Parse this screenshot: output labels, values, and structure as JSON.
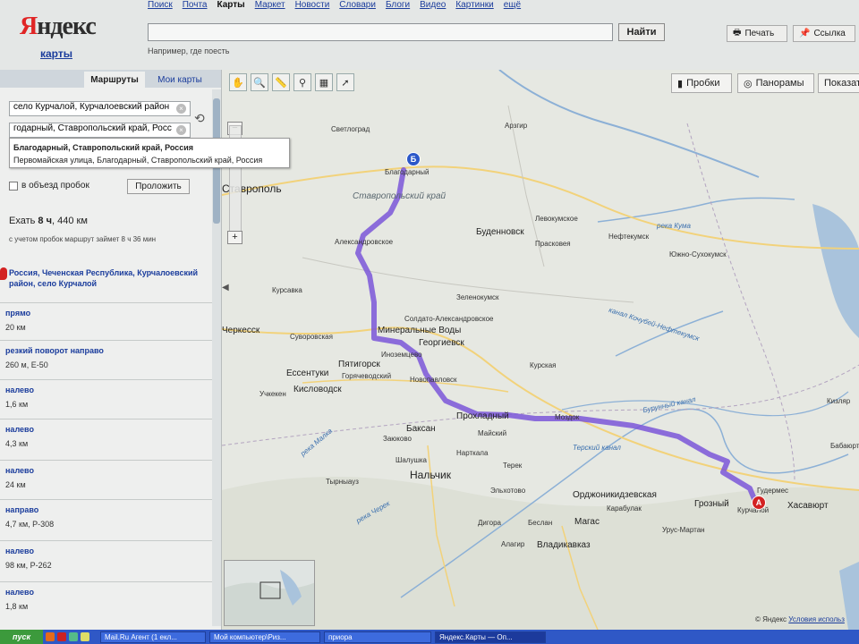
{
  "header": {
    "logo_first": "Я",
    "logo_rest": "ндекс",
    "service": "карты",
    "nav": [
      "Поиск",
      "Почта",
      "Карты",
      "Маркет",
      "Новости",
      "Словари",
      "Блоги",
      "Видео",
      "Картинки",
      "ещё"
    ],
    "active_nav": "Карты",
    "search_value": "",
    "find_label": "Найти",
    "search_hint": "Например, где поесть",
    "print_label": "Печать",
    "link_label": "Ссылка"
  },
  "sidebar": {
    "tab_routes": "Маршруты",
    "tab_mymaps": "Мои карты",
    "from_value": "село Курчалой, Курчалоевский район",
    "to_value": "годарный, Ставропольский край, Росс",
    "suggestions": [
      "Благодарный, Ставропольский край, Россия",
      "Первомайская улица, Благодарный, Ставропольский край, Россия"
    ],
    "avoid_label": "в объезд пробок",
    "build_label": "Проложить",
    "summary_prefix": "Ехать",
    "summary_time": "8 ч",
    "summary_dist": "440 км",
    "summary_traffic": "с учетом пробок маршрут займет 8 ч 36 мин",
    "start_address": "Россия, Чеченская Республика, Курчалоевский район, село Курчалой",
    "steps": [
      {
        "title": "прямо",
        "detail": "20 км"
      },
      {
        "title": "резкий поворот направо",
        "detail": "260 м, Е-50"
      },
      {
        "title": "налево",
        "detail": "1,6 км"
      },
      {
        "title": "налево",
        "detail": "4,3 км"
      },
      {
        "title": "налево",
        "detail": "24 км"
      },
      {
        "title": "направо",
        "detail": "4,7 км, Р-308"
      },
      {
        "title": "налево",
        "detail": "98 км, Р-262"
      },
      {
        "title": "налево",
        "detail": "1,8 км"
      }
    ]
  },
  "map": {
    "buttons": [
      "Пробки",
      "Панорамы",
      "Показать"
    ],
    "pin_a": "А",
    "pin_b": "Б",
    "copyright_prefix": "© Яндекс",
    "copyright_link": "Условия использ",
    "cities": [
      {
        "name": "Ставрополь",
        "cls": "big"
      },
      {
        "name": "Благодарный",
        "cls": "small"
      },
      {
        "name": "Буденновск",
        "cls": ""
      },
      {
        "name": "Светлоград",
        "cls": "small"
      },
      {
        "name": "Левокумское",
        "cls": "small"
      },
      {
        "name": "Прасковея",
        "cls": "small"
      },
      {
        "name": "Нефтекумск",
        "cls": "small"
      },
      {
        "name": "Александровское",
        "cls": "small"
      },
      {
        "name": "Южно-Сухокумск",
        "cls": "small"
      },
      {
        "name": "Зеленокумск",
        "cls": "small"
      },
      {
        "name": "Курсавка",
        "cls": "small"
      },
      {
        "name": "Солдато-Александровское",
        "cls": "small"
      },
      {
        "name": "Минеральные Воды",
        "cls": ""
      },
      {
        "name": "Суворовская",
        "cls": "small"
      },
      {
        "name": "Георгиевск",
        "cls": ""
      },
      {
        "name": "Пятигорск",
        "cls": ""
      },
      {
        "name": "Ессентуки",
        "cls": ""
      },
      {
        "name": "Кисловодск",
        "cls": ""
      },
      {
        "name": "Иноземцево",
        "cls": "small"
      },
      {
        "name": "Горячеводский",
        "cls": "small"
      },
      {
        "name": "Новопавловск",
        "cls": "small"
      },
      {
        "name": "Курская",
        "cls": "small"
      },
      {
        "name": "Прохладный",
        "cls": ""
      },
      {
        "name": "Баксан",
        "cls": ""
      },
      {
        "name": "Майский",
        "cls": "small"
      },
      {
        "name": "Заюково",
        "cls": "small"
      },
      {
        "name": "Нарткала",
        "cls": "small"
      },
      {
        "name": "Шалушка",
        "cls": "small"
      },
      {
        "name": "Нальчик",
        "cls": "big"
      },
      {
        "name": "Терек",
        "cls": "small"
      },
      {
        "name": "Моздок",
        "cls": "small"
      },
      {
        "name": "Орджоникидзевская",
        "cls": ""
      },
      {
        "name": "Грозный",
        "cls": ""
      },
      {
        "name": "Хасавюрт",
        "cls": ""
      },
      {
        "name": "Магас",
        "cls": ""
      },
      {
        "name": "Владикавказ",
        "cls": ""
      },
      {
        "name": "Беслан",
        "cls": "small"
      },
      {
        "name": "Эльхотово",
        "cls": "small"
      },
      {
        "name": "Дигора",
        "cls": "small"
      },
      {
        "name": "Алагир",
        "cls": "small"
      },
      {
        "name": "Урус-Мартан",
        "cls": "small"
      },
      {
        "name": "Тырныауз",
        "cls": "small"
      },
      {
        "name": "Кизляр",
        "cls": "small"
      },
      {
        "name": "Бабаюрт",
        "cls": "small"
      },
      {
        "name": "Арзгир",
        "cls": "small"
      },
      {
        "name": "Черкесск",
        "cls": ""
      },
      {
        "name": "Учкекен",
        "cls": "small"
      },
      {
        "name": "Карабулак",
        "cls": "small"
      },
      {
        "name": "Гудермес",
        "cls": "small"
      },
      {
        "name": "Курчалой",
        "cls": "small"
      }
    ],
    "regions": [
      "Ставропольский край"
    ],
    "water": [
      "река Кума",
      "канал Кочубей-Нефтекумск",
      "Бурунный канал",
      "Терский канал",
      "река Малка",
      "река Черек"
    ]
  },
  "taskbar": {
    "start": "пуск",
    "tasks": [
      "Mail.Ru Агент (1 екл...",
      "Мой компьютер\\Риз...",
      "приора",
      "Яндекс.Карты — Оп..."
    ],
    "active_task": 3
  },
  "colors": {
    "route": "#7a56d8",
    "link": "#1a3c9c",
    "logo_red": "#e02525"
  }
}
